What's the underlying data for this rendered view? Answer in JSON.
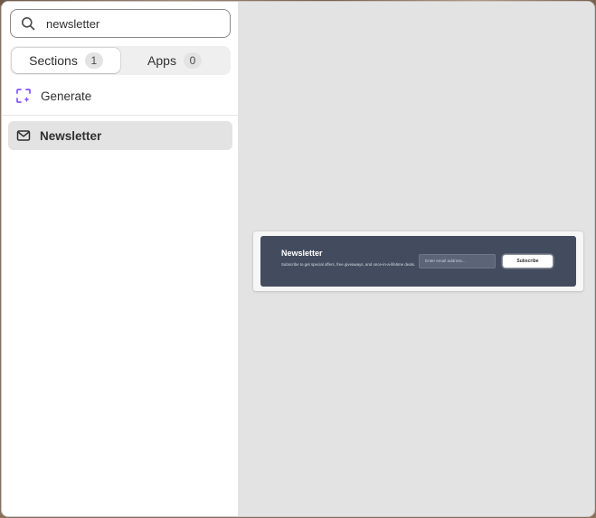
{
  "search": {
    "value": "newsletter",
    "icon": "search-icon"
  },
  "tabs": [
    {
      "label": "Sections",
      "count": "1",
      "active": true
    },
    {
      "label": "Apps",
      "count": "0",
      "active": false
    }
  ],
  "generate": {
    "label": "Generate",
    "icon": "sparkle-frame-icon",
    "icon_color": "#8051ff"
  },
  "results": [
    {
      "label": "Newsletter",
      "icon": "envelope-icon",
      "selected": true
    }
  ],
  "preview": {
    "title": "Newsletter",
    "description": "Subscribe to get special offers, free giveaways, and once-in-a-lifetime deals.",
    "email_placeholder": "Enter email address...",
    "button_label": "Subscribe",
    "banner_color": "#434c5f"
  }
}
